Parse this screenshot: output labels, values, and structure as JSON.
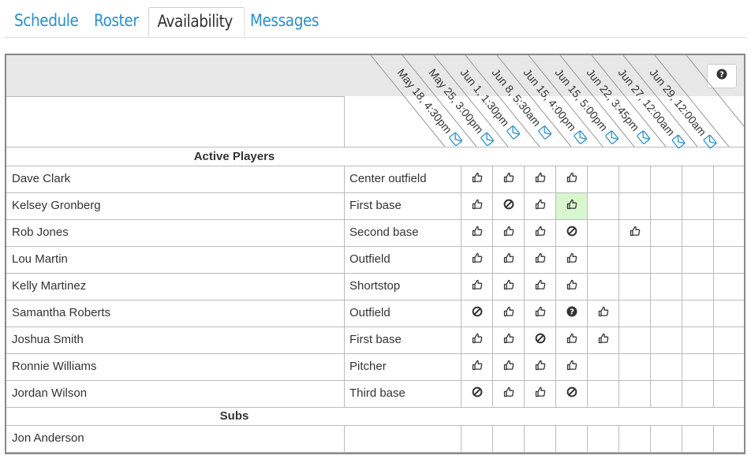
{
  "tabs": [
    {
      "label": "Schedule",
      "active": false
    },
    {
      "label": "Roster",
      "active": false
    },
    {
      "label": "Availability",
      "active": true
    },
    {
      "label": "Messages",
      "active": false
    }
  ],
  "columns": [
    "May 18, 4:30pm",
    "May 25, 3:00pm",
    "Jun 1, 1:30pm",
    "Jun 8, 5:30am",
    "Jun 15, 4:00pm",
    "Jun 15, 5:00pm",
    "Jun 22, 3:45pm",
    "Jun 27, 12:00am",
    "Jun 29, 12:00am"
  ],
  "sections": [
    {
      "title": "Active Players",
      "rows": [
        {
          "name": "Dave Clark",
          "position": "Center outfield",
          "avail": [
            "yes",
            "yes",
            "yes",
            "yes",
            "",
            "",
            "",
            "",
            ""
          ]
        },
        {
          "name": "Kelsey Gronberg",
          "position": "First base",
          "avail": [
            "yes",
            "no",
            "yes",
            "yes-hl",
            "",
            "",
            "",
            "",
            ""
          ]
        },
        {
          "name": "Rob Jones",
          "position": "Second base",
          "avail": [
            "yes",
            "yes",
            "yes",
            "no",
            "",
            "yes",
            "",
            "",
            ""
          ]
        },
        {
          "name": "Lou Martin",
          "position": "Outfield",
          "avail": [
            "yes",
            "yes",
            "yes",
            "yes",
            "",
            "",
            "",
            "",
            ""
          ]
        },
        {
          "name": "Kelly Martinez",
          "position": "Shortstop",
          "avail": [
            "yes",
            "yes",
            "yes",
            "yes",
            "",
            "",
            "",
            "",
            ""
          ]
        },
        {
          "name": "Samantha Roberts",
          "position": "Outfield",
          "avail": [
            "no",
            "yes",
            "yes",
            "maybe",
            "yes",
            "",
            "",
            "",
            ""
          ]
        },
        {
          "name": "Joshua Smith",
          "position": "First base",
          "avail": [
            "yes",
            "yes",
            "no",
            "yes",
            "yes",
            "",
            "",
            "",
            ""
          ]
        },
        {
          "name": "Ronnie Williams",
          "position": "Pitcher",
          "avail": [
            "yes",
            "yes",
            "yes",
            "yes",
            "",
            "",
            "",
            "",
            ""
          ]
        },
        {
          "name": "Jordan Wilson",
          "position": "Third base",
          "avail": [
            "no",
            "yes",
            "yes",
            "no",
            "",
            "",
            "",
            "",
            ""
          ]
        }
      ]
    },
    {
      "title": "Subs",
      "rows": [
        {
          "name": "Jon Anderson",
          "position": "",
          "avail": [
            "",
            "",
            "",
            "",
            "",
            "",
            "",
            "",
            ""
          ]
        }
      ]
    }
  ],
  "icons": {
    "yes": "thumbs-up-icon",
    "no": "ban-icon",
    "maybe": "question-circle-icon",
    "mail": "envelope-icon",
    "help": "question-circle-icon"
  },
  "colors": {
    "tab_link": "#2a8fc7",
    "highlight": "#d9f7cf",
    "header_band": "#e8e8e8",
    "mail_icon": "#2a8fc7"
  }
}
